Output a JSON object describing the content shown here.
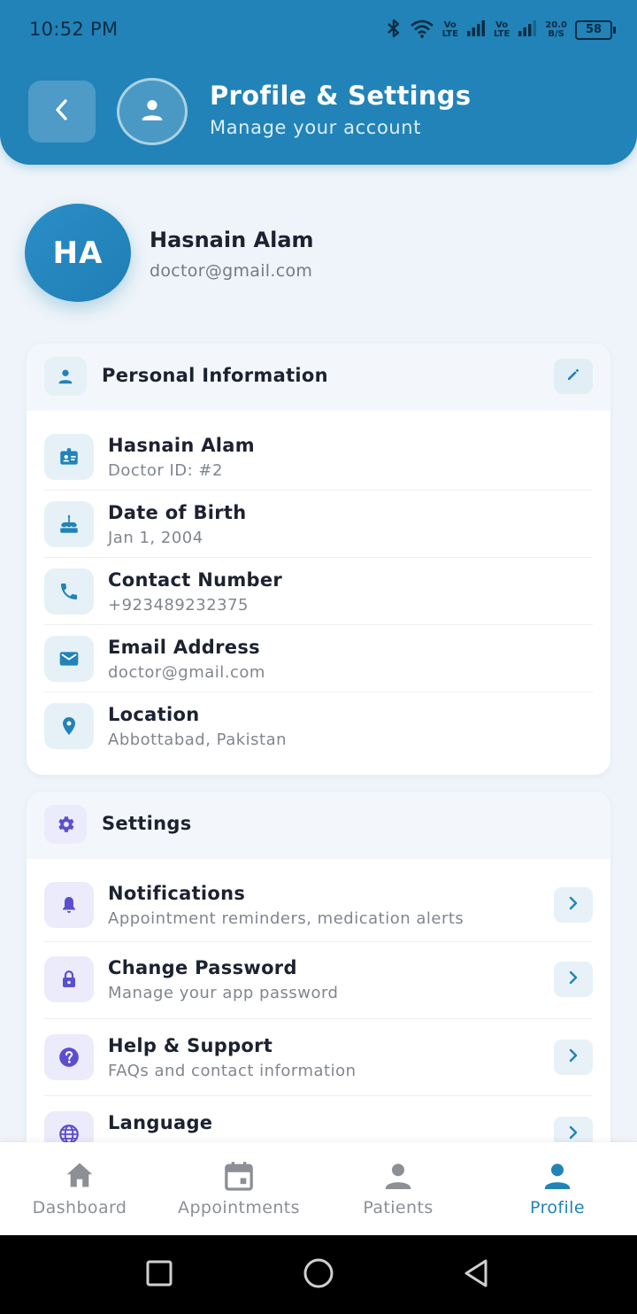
{
  "status_bar": {
    "time": "10:52 PM",
    "net1": "Vo\nLTE",
    "net2": "Vo\nLTE",
    "speed": "20.0\nB/S",
    "battery": "58"
  },
  "header": {
    "title": "Profile & Settings",
    "subtitle": "Manage your account"
  },
  "profile": {
    "initials": "HA",
    "name": "Hasnain Alam",
    "email": "doctor@gmail.com"
  },
  "personal_info": {
    "title": "Personal Information",
    "rows": [
      {
        "icon": "id-badge-icon",
        "title": "Hasnain Alam",
        "subtitle": "Doctor ID: #2"
      },
      {
        "icon": "cake-icon",
        "title": "Date of Birth",
        "subtitle": "Jan 1, 2004"
      },
      {
        "icon": "phone-icon",
        "title": "Contact Number",
        "subtitle": "+923489232375"
      },
      {
        "icon": "email-icon",
        "title": "Email Address",
        "subtitle": "doctor@gmail.com"
      },
      {
        "icon": "location-pin-icon",
        "title": "Location",
        "subtitle": "Abbottabad, Pakistan"
      }
    ]
  },
  "settings": {
    "title": "Settings",
    "rows": [
      {
        "icon": "bell-icon",
        "title": "Notifications",
        "subtitle": "Appointment reminders, medication alerts"
      },
      {
        "icon": "lock-icon",
        "title": "Change Password",
        "subtitle": "Manage your app password"
      },
      {
        "icon": "help-icon",
        "title": "Help & Support",
        "subtitle": "FAQs and contact information"
      },
      {
        "icon": "globe-icon",
        "title": "Language",
        "subtitle": ""
      }
    ]
  },
  "bottom_nav": {
    "items": [
      {
        "label": "Dashboard",
        "icon": "home-icon",
        "active": false
      },
      {
        "label": "Appointments",
        "icon": "calendar-icon",
        "active": false
      },
      {
        "label": "Patients",
        "icon": "person-icon",
        "active": false
      },
      {
        "label": "Profile",
        "icon": "person-icon",
        "active": true
      }
    ]
  },
  "colors": {
    "primary": "#2183b8",
    "settings_accent": "#5b4fcf",
    "inactive_nav": "#8c9096"
  }
}
